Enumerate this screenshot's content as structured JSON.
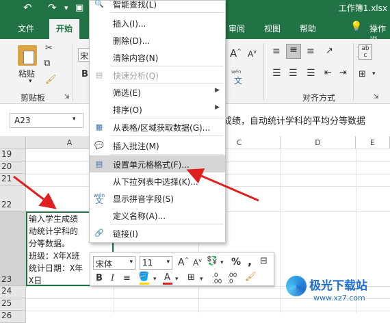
{
  "title_bar": {
    "document_title": "工作簿1.xlsx",
    "quick_access": [
      "undo-icon",
      "redo-icon",
      "save-icon"
    ]
  },
  "tabs": [
    {
      "label": "文件"
    },
    {
      "label": "开始"
    },
    {
      "label": "审阅"
    },
    {
      "label": "视图"
    },
    {
      "label": "帮助"
    },
    {
      "label": "操作说"
    }
  ],
  "ribbon": {
    "paste_label": "粘贴",
    "clipboard_group": "剪贴板",
    "alignment_group": "对齐方式",
    "font_name_partial": "宋",
    "wen_label": "wén",
    "wen_char": "文"
  },
  "formula_bar": {
    "name_box": "A23",
    "formula_text": "成绩，自动统计学科的平均分等数据"
  },
  "grid": {
    "columns": [
      "A",
      "C",
      "D",
      "E"
    ],
    "rows": [
      "19",
      "20",
      "21",
      "22",
      "23",
      "24",
      "25",
      "26"
    ],
    "cell_a23_lines": [
      "输入学生成绩",
      "动统计学科的",
      "分等数据。",
      "班级：X年X班",
      "统计日期：X年",
      "X日"
    ]
  },
  "context_menu": {
    "items": [
      {
        "label": "智能查找(L)",
        "icon": "search-icon",
        "disabled": false
      },
      {
        "label": "插入(I)...",
        "icon": "",
        "disabled": false
      },
      {
        "label": "删除(D)...",
        "icon": "",
        "disabled": false
      },
      {
        "label": "清除内容(N)",
        "icon": "",
        "disabled": false
      },
      {
        "label": "快速分析(Q)",
        "icon": "quick-analysis-icon",
        "disabled": true
      },
      {
        "label": "筛选(E)",
        "icon": "",
        "disabled": false,
        "submenu": true
      },
      {
        "label": "排序(O)",
        "icon": "",
        "disabled": false,
        "submenu": true
      },
      {
        "label": "从表格/区域获取数据(G)...",
        "icon": "table-icon",
        "disabled": false
      },
      {
        "label": "插入批注(M)",
        "icon": "comment-icon",
        "disabled": false
      },
      {
        "label": "设置单元格格式(F)...",
        "icon": "format-cells-icon",
        "disabled": false,
        "highlighted": true
      },
      {
        "label": "从下拉列表中选择(K)...",
        "icon": "",
        "disabled": false
      },
      {
        "label": "显示拼音字段(S)",
        "icon": "phonetic-icon",
        "disabled": false
      },
      {
        "label": "定义名称(A)...",
        "icon": "",
        "disabled": false
      },
      {
        "label": "链接(I)",
        "icon": "link-icon",
        "disabled": false
      }
    ]
  },
  "mini_toolbar": {
    "font_name": "宋体",
    "font_size": "11",
    "bold": "B",
    "italic": "I",
    "percent": "%",
    "comma": ","
  },
  "watermark": {
    "brand": "极光下载站",
    "url": "www.xz7.com"
  },
  "colors": {
    "accent": "#217346",
    "annotation_arrow": "#e02020",
    "highlight": "#d6d6d6"
  }
}
